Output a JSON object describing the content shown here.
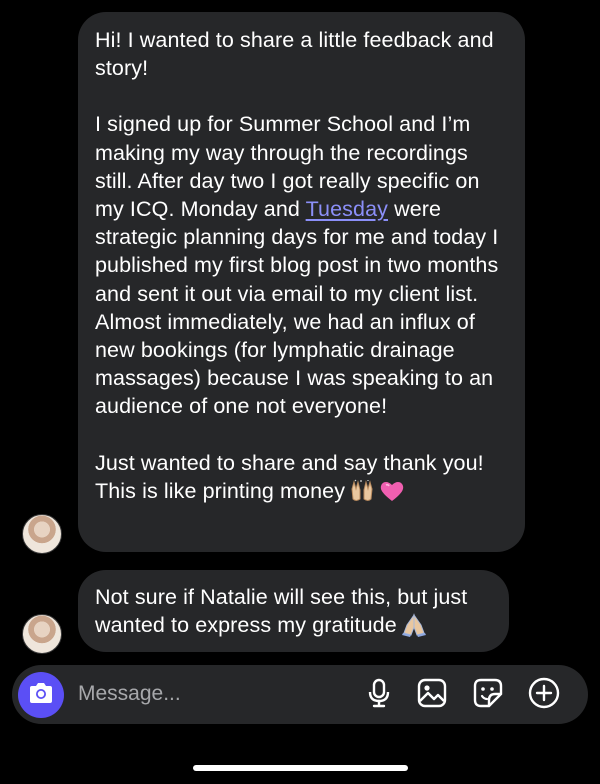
{
  "messages": [
    {
      "paragraphs": [
        "Hi! I wanted to share a little feedback and story!",
        {
          "before": "I signed up for Summer School and I’m making my way through the recordings still. After day two I got really specific on my ICQ. Monday and ",
          "link": "Tuesday",
          "after": " were strategic planning days for me and today I published my first blog post in two months and sent it out via email to my client list. Almost immediately, we had an influx of new bookings (for lymphatic drainage massages) because I was speaking to an audience of one not everyone!"
        },
        "Just wanted to share and say thank you! This is like printing money"
      ],
      "emojis": [
        "🙌🏼",
        "💗"
      ]
    },
    {
      "text": "Not sure if Natalie will see this, but just wanted to express my gratitude",
      "emoji": "🙏🏼"
    }
  ],
  "composer": {
    "placeholder": "Message...",
    "icons": [
      "camera-icon",
      "microphone-icon",
      "photo-icon",
      "sticker-icon",
      "plus-icon"
    ]
  },
  "colors": {
    "background": "#000000",
    "bubble": "#262729",
    "accent": "#5b4ff5",
    "link": "#8b8ff8",
    "placeholder": "#a7a8ab"
  }
}
